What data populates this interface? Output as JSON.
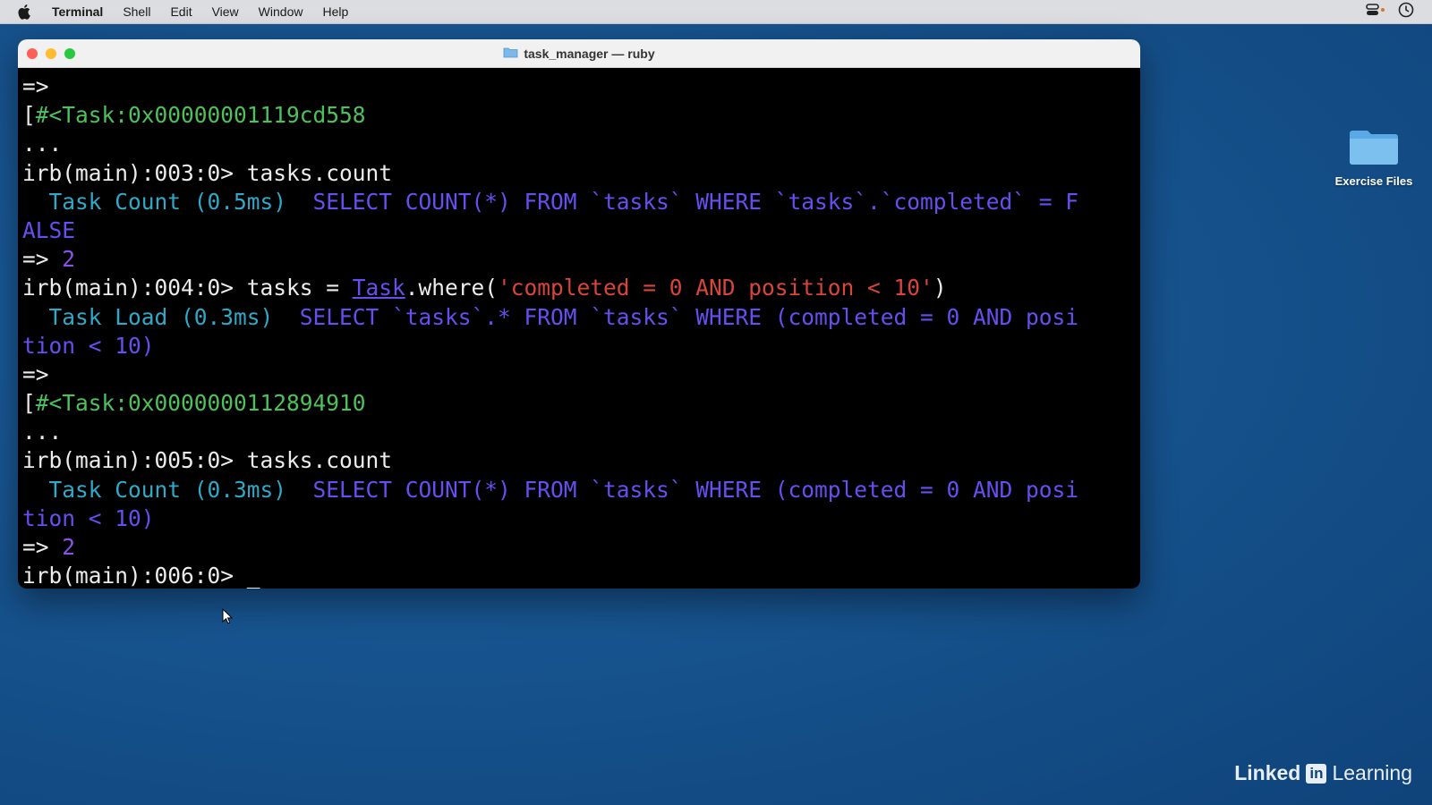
{
  "menubar": {
    "app_name": "Terminal",
    "items": [
      "Shell",
      "Edit",
      "View",
      "Window",
      "Help"
    ]
  },
  "window": {
    "title": "task_manager — ruby"
  },
  "terminal": {
    "lines": [
      [
        {
          "t": "=>",
          "c": "white"
        }
      ],
      [
        {
          "t": "[",
          "c": "white"
        },
        {
          "t": "#<Task:0x00000001119cd558",
          "c": "green"
        }
      ],
      [
        {
          "t": "...",
          "c": "white"
        }
      ],
      [
        {
          "t": "irb(main):003:0> tasks.count",
          "c": "white"
        }
      ],
      [
        {
          "t": "  Task Count (0.5ms)  ",
          "c": "cyan"
        },
        {
          "t": "SELECT COUNT(*) FROM `tasks` WHERE `tasks`.`completed` = F",
          "c": "blue"
        }
      ],
      [
        {
          "t": "ALSE",
          "c": "blue"
        }
      ],
      [
        {
          "t": "=> ",
          "c": "white"
        },
        {
          "t": "2",
          "c": "purple"
        }
      ],
      [
        {
          "t": "irb(main):004:0> tasks = ",
          "c": "white"
        },
        {
          "t": "Task",
          "c": "link"
        },
        {
          "t": ".where(",
          "c": "white"
        },
        {
          "t": "'completed = 0 AND position < 10'",
          "c": "red"
        },
        {
          "t": ")",
          "c": "white"
        }
      ],
      [
        {
          "t": "  Task Load (0.3ms)  ",
          "c": "cyan"
        },
        {
          "t": "SELECT `tasks`.* FROM `tasks` WHERE (completed = 0 AND posi",
          "c": "blue"
        }
      ],
      [
        {
          "t": "tion < 10)",
          "c": "blue"
        }
      ],
      [
        {
          "t": "=>",
          "c": "white"
        }
      ],
      [
        {
          "t": "[",
          "c": "white"
        },
        {
          "t": "#<Task:0x0000000112894910",
          "c": "green"
        }
      ],
      [
        {
          "t": "...",
          "c": "white"
        }
      ],
      [
        {
          "t": "irb(main):005:0> tasks.count",
          "c": "white"
        }
      ],
      [
        {
          "t": "  Task Count (0.3ms)  ",
          "c": "cyan"
        },
        {
          "t": "SELECT COUNT(*) FROM `tasks` WHERE (completed = 0 AND posi",
          "c": "blue"
        }
      ],
      [
        {
          "t": "tion < 10)",
          "c": "blue"
        }
      ],
      [
        {
          "t": "=> ",
          "c": "white"
        },
        {
          "t": "2",
          "c": "purple"
        }
      ],
      [
        {
          "t": "irb(main):006:0> ",
          "c": "white"
        },
        {
          "t": "_",
          "c": "cursor"
        }
      ]
    ]
  },
  "desktop": {
    "folder_label": "Exercise Files"
  },
  "branding": {
    "part1": "Linked",
    "badge": "in",
    "part2": "Learning"
  },
  "colors": {
    "desktop_bg": "#17548f",
    "terminal_bg": "#000000",
    "green": "#4dc25a",
    "cyan": "#2fa9c7",
    "blue": "#6a4df0",
    "red": "#d8453a"
  }
}
